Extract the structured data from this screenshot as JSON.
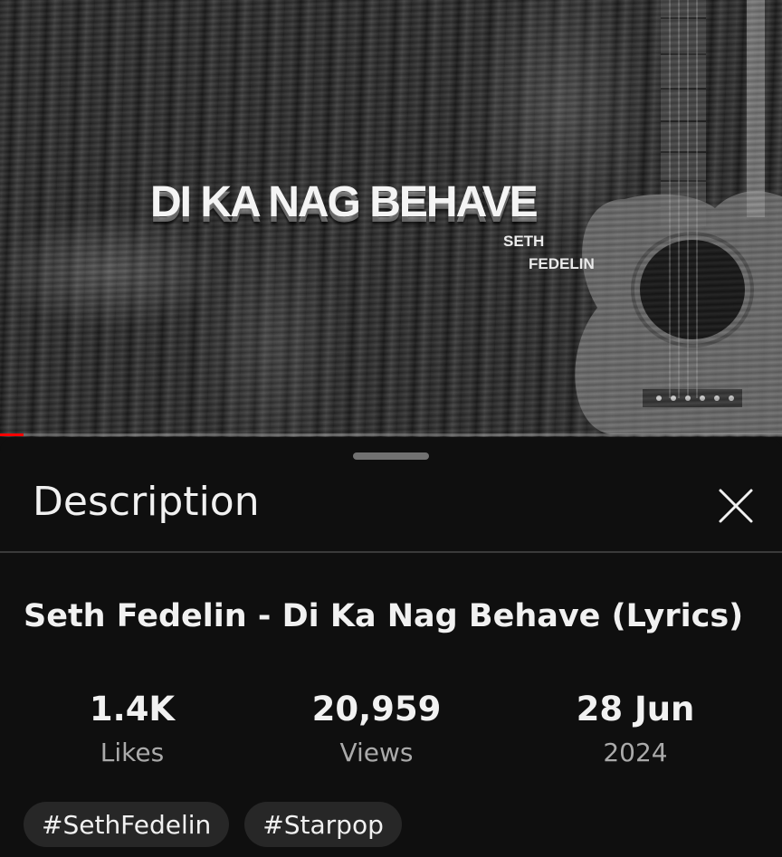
{
  "video": {
    "art_title": "DI KA NAG BEHAVE",
    "art_artist_first": "SETH",
    "art_artist_last": "FEDELIN",
    "progress": 0.03
  },
  "sheet": {
    "title": "Description",
    "close_icon": "close-icon"
  },
  "description": {
    "title": "Seth Fedelin - Di Ka Nag Behave (Lyrics)",
    "stats": {
      "likes_value": "1.4K",
      "likes_label": "Likes",
      "views_value": "20,959",
      "views_label": "Views",
      "date_value": "28 Jun",
      "date_label": "2024"
    },
    "hashtags": [
      "#SethFedelin",
      "#Starpop"
    ]
  },
  "colors": {
    "background": "#0f0f0f",
    "chip": "#272727",
    "secondary_text": "#aaaaaa",
    "progress": "#ff0000"
  }
}
